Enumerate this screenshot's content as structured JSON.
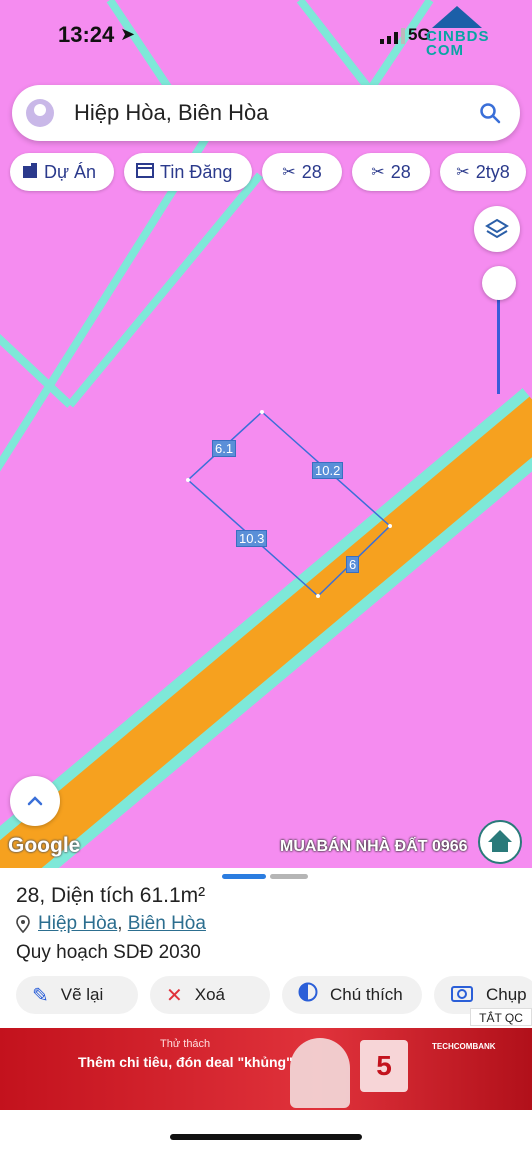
{
  "status_bar": {
    "time": "13:24",
    "network": "5G",
    "watermark_logo": "CINBDS COM"
  },
  "search": {
    "query": "Hiệp Hòa, Biên Hòa"
  },
  "chips": [
    {
      "label": "Dự Án",
      "icon": "building-icon"
    },
    {
      "label": "Tin Đăng",
      "icon": "calendar-icon"
    },
    {
      "label": "28",
      "icon": "parcel-icon"
    },
    {
      "label": "28",
      "icon": "parcel-icon"
    },
    {
      "label": "2ty8",
      "icon": "parcel-icon"
    }
  ],
  "map": {
    "dimensions": {
      "top_left": "6.1",
      "top_right": "10.2",
      "bottom_left": "10.3",
      "bottom_right": "6"
    },
    "attribution": "Google",
    "watermark": "MUABÁN NHÀ ĐẤT 0966"
  },
  "sheet": {
    "title_number": "28,",
    "title_area_label": "Diện tích",
    "title_area_value": "61.1m²",
    "location_ward": "Hiệp Hòa",
    "location_sep": ",",
    "location_city": "Biên Hòa",
    "plan": "Quy hoạch SDĐ 2030",
    "actions": {
      "redraw": "Vẽ lại",
      "delete": "Xoá",
      "legend": "Chú thích",
      "capture": "Chụp ả"
    }
  },
  "ad": {
    "close_label": "TẮT QC",
    "challenge": "Thử thách",
    "headline": "Thêm chi tiêu, đón deal \"khủng\"",
    "brand": "TECHCOMBANK",
    "badge": "5"
  },
  "colors": {
    "map_land": "#f58cf0",
    "road": "#f6a11f",
    "road_edge": "#7ee8d8",
    "accent": "#2b3a8c"
  }
}
